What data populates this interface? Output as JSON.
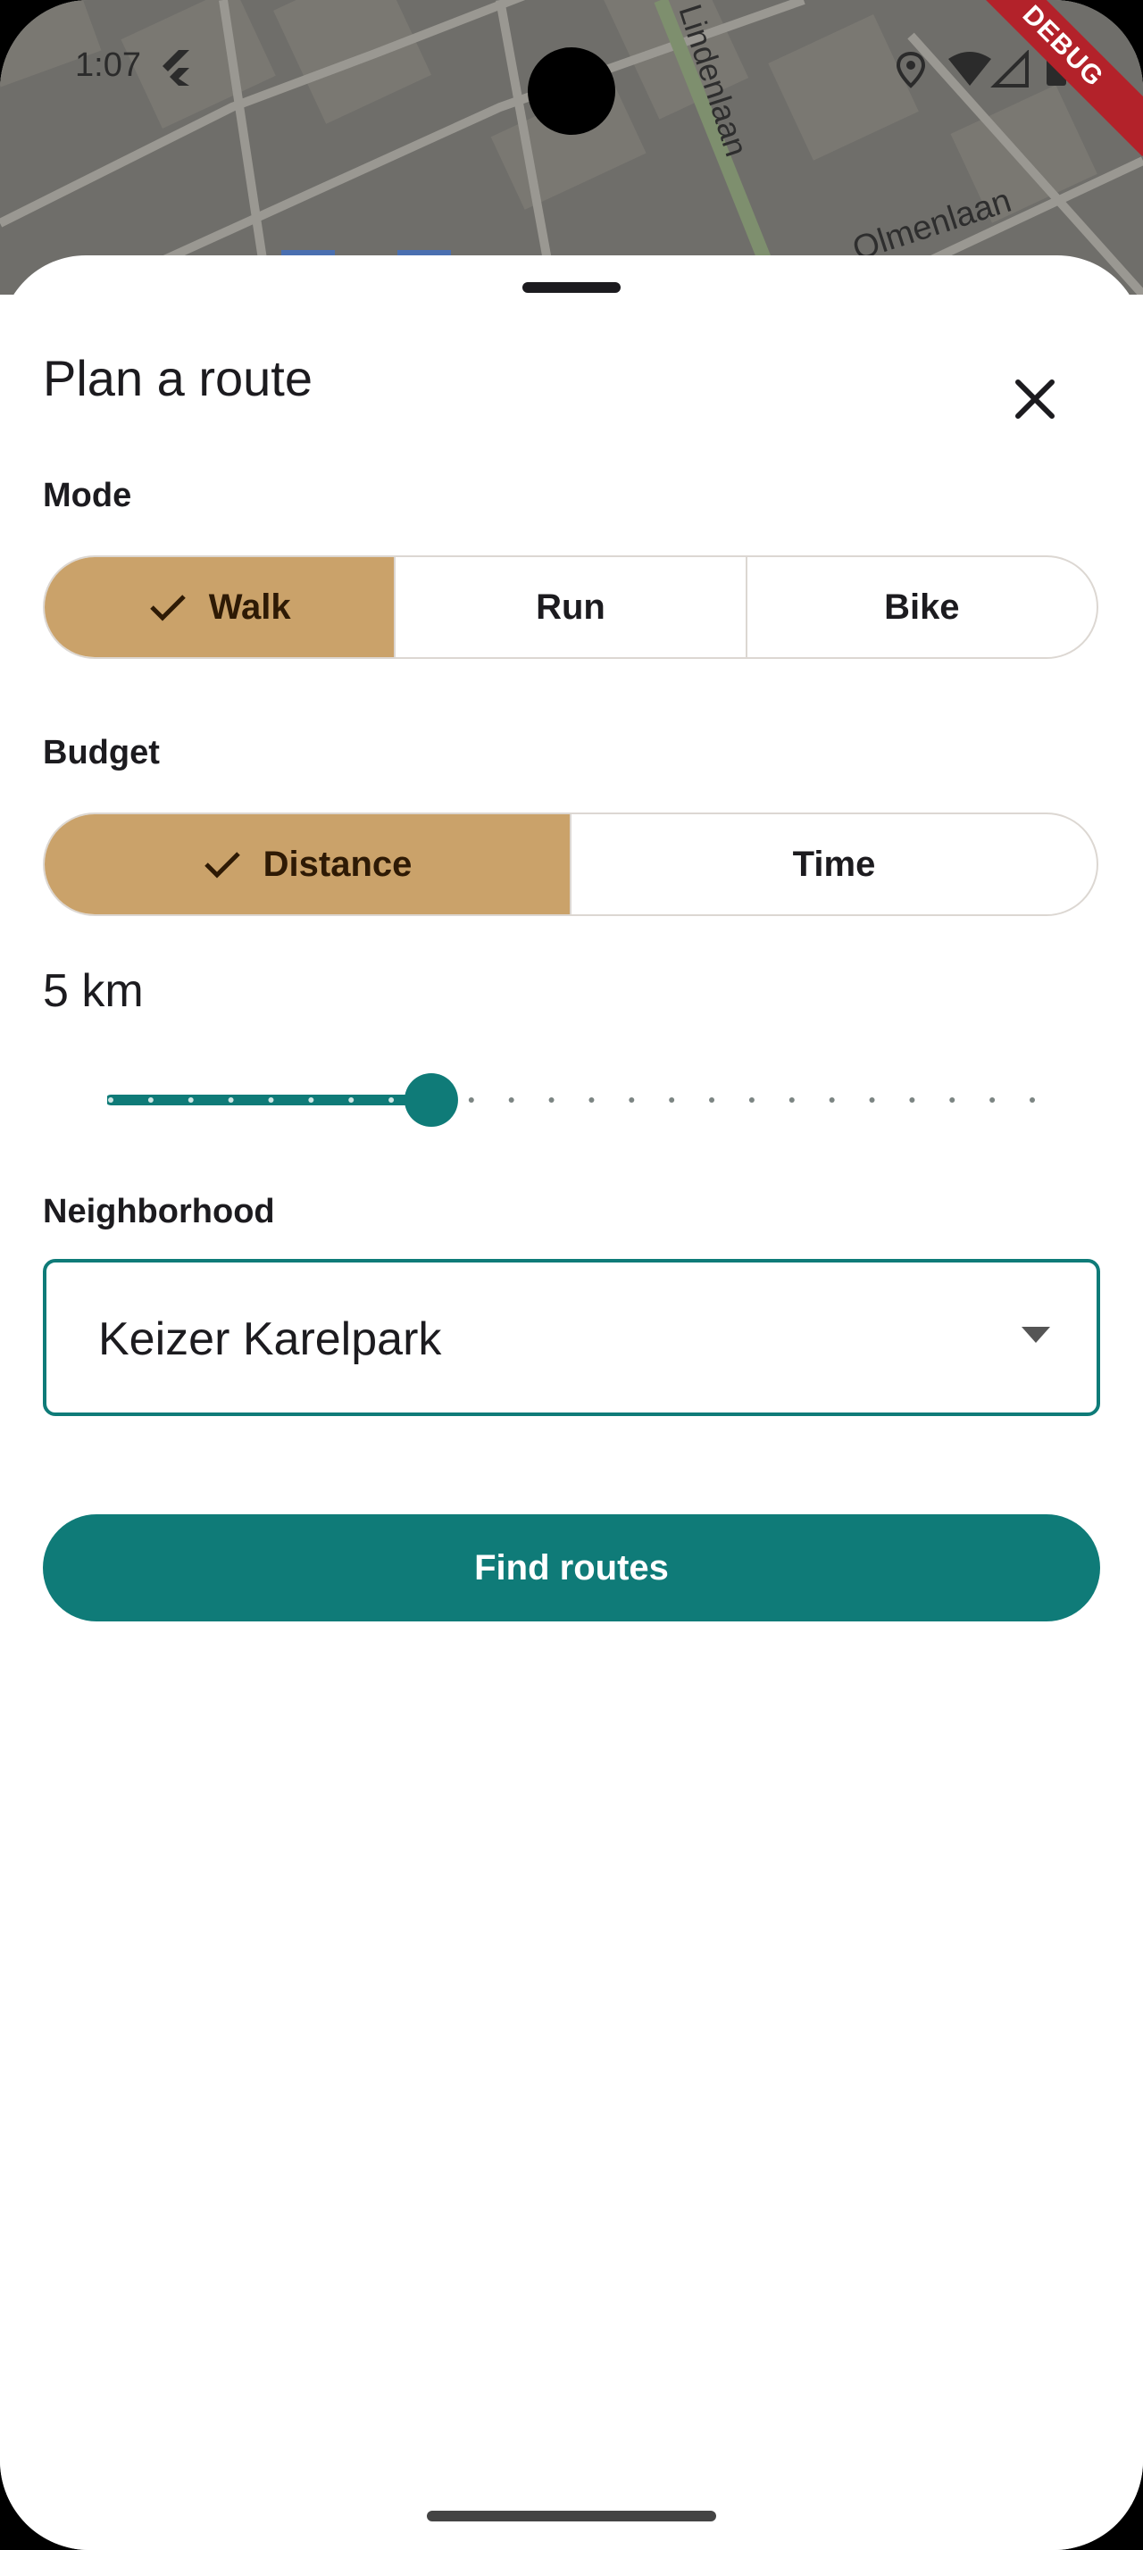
{
  "status_bar": {
    "time": "1:07",
    "icons": [
      "flutter-icon",
      "location-icon",
      "wifi-icon",
      "signal-icon",
      "battery-icon"
    ],
    "debug_banner": "DEBUG"
  },
  "map": {
    "street_labels": [
      "Lindenlaan",
      "Olmenlaan"
    ]
  },
  "sheet": {
    "title": "Plan a route",
    "close_icon": "close-icon",
    "mode": {
      "label": "Mode",
      "options": [
        "Walk",
        "Run",
        "Bike"
      ],
      "selected": "Walk"
    },
    "budget": {
      "label": "Budget",
      "options": [
        "Distance",
        "Time"
      ],
      "selected": "Distance",
      "value_text": "5 km",
      "slider_value": 5,
      "slider_min": 1,
      "slider_max": 20,
      "slider_steps": 19
    },
    "neighborhood": {
      "label": "Neighborhood",
      "selected": "Keizer Karelpark"
    },
    "find_button": "Find routes"
  },
  "colors": {
    "accent": "#0f7b78",
    "selected_segment": "#caa26a",
    "debug_banner": "#b3222a"
  }
}
